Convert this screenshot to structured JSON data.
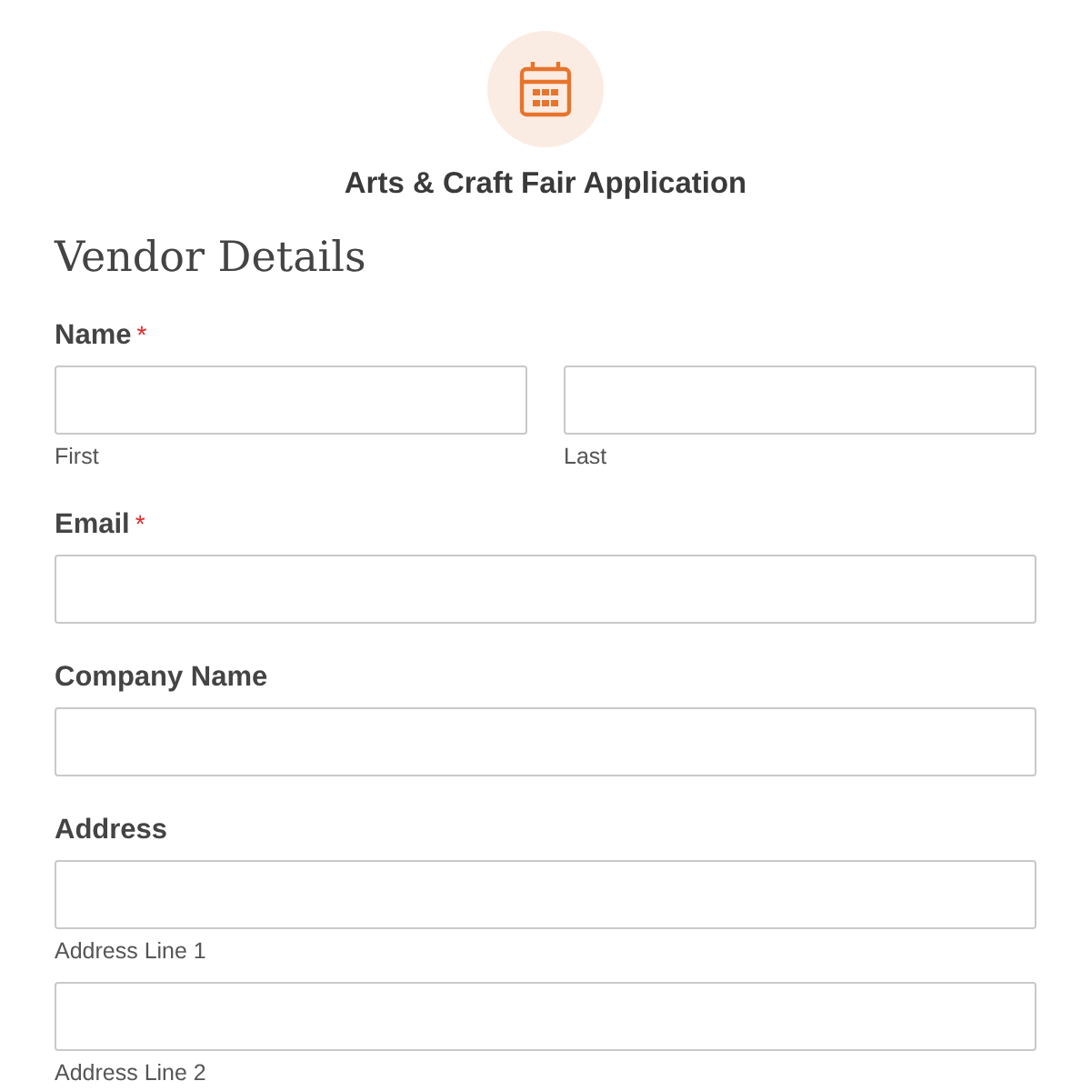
{
  "form": {
    "title": "Arts & Craft Fair Application"
  },
  "section": {
    "heading": "Vendor Details"
  },
  "fields": [
    {
      "kind": "split",
      "label": "Name",
      "required_mark": "*",
      "sublabels": [
        "First",
        "Last"
      ]
    },
    {
      "kind": "single",
      "label": "Email",
      "required_mark": "*"
    },
    {
      "kind": "single",
      "label": "Company Name"
    },
    {
      "kind": "stacked",
      "label": "Address",
      "sublabels": [
        "Address Line 1",
        "Address Line 2"
      ]
    }
  ]
}
